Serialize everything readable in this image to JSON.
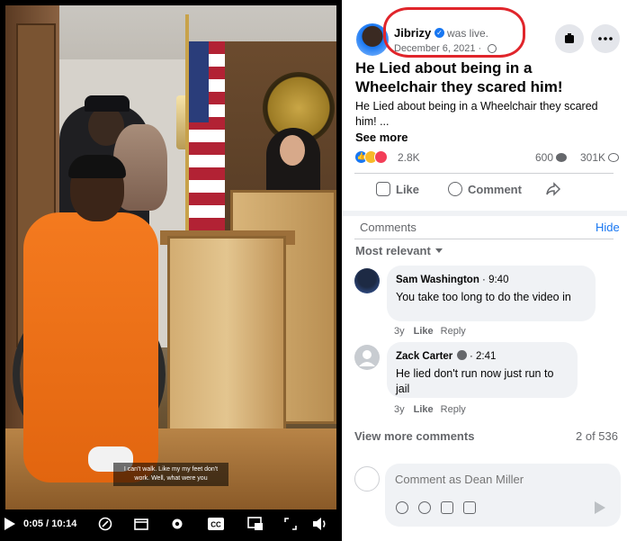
{
  "video": {
    "subtitle": "I can't walk. Like my my feet don't work. Well, what were you",
    "time_current": "0:05",
    "time_separator": " / ",
    "time_total": "10:14"
  },
  "post": {
    "author": "Jibrizy",
    "status": "was live.",
    "date": "December 6, 2021 ·",
    "title": "He Lied about being in a Wheelchair they scared him!",
    "description": "He Lied about being in a Wheelchair they scared him! ...",
    "see_more": "See more",
    "reaction_count": "2.8K",
    "comment_count": "600",
    "view_count": "301K",
    "actions": {
      "like": "Like",
      "comment": "Comment"
    }
  },
  "comments_section": {
    "header": "Comments",
    "hide": "Hide",
    "sort": "Most relevant",
    "items": [
      {
        "name": "Sam Washington",
        "time": "9:40",
        "text": "You take too long to do the video in",
        "age": "3y",
        "like": "Like",
        "reply": "Reply"
      },
      {
        "name": "Zack Carter",
        "time": "2:41",
        "text": "He lied don't run now just run to jail",
        "age": "3y",
        "like": "Like",
        "reply": "Reply"
      }
    ],
    "view_more": "View more comments",
    "page_count": "2 of 536",
    "composer_placeholder": "Comment as Dean Miller"
  },
  "colors": {
    "accent": "#1877f2",
    "highlight": "#e0252b",
    "jumpsuit": "#f47a1f"
  },
  "icons": [
    "play-icon",
    "captions-icon",
    "clip-icon",
    "gear-icon",
    "cc-icon",
    "pip-icon",
    "fullscreen-icon",
    "volume-icon",
    "bookmark-icon",
    "more-icon",
    "globe-icon",
    "verified-icon"
  ]
}
